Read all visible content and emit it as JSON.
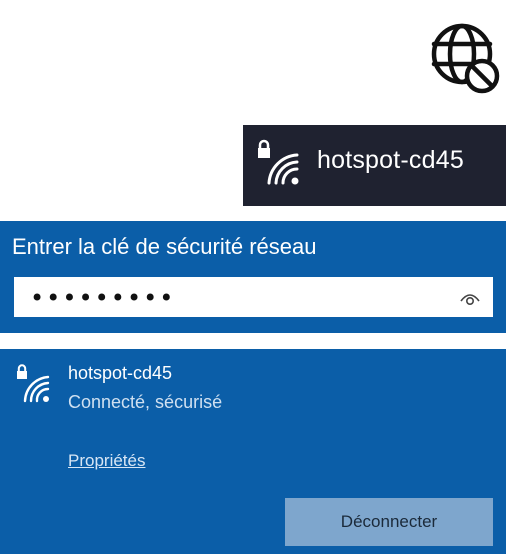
{
  "tray": {
    "network_name": "hotspot-cd45",
    "icons": [
      "wifi-locked-icon"
    ]
  },
  "globe": {
    "icon": "globe-no-internet-icon"
  },
  "password_prompt": {
    "label": "Entrer la clé de sécurité réseau",
    "value": "•••••••••",
    "reveal_icon": "eye-icon"
  },
  "network": {
    "name": "hotspot-cd45",
    "status": "Connecté, sécurisé",
    "properties_link": "Propriétés",
    "disconnect_label": "Déconnecter",
    "icon": "wifi-locked-icon"
  },
  "colors": {
    "panel_blue": "#0b5ea8",
    "tray_dark": "#1f2230",
    "button": "#7ea6cd"
  }
}
